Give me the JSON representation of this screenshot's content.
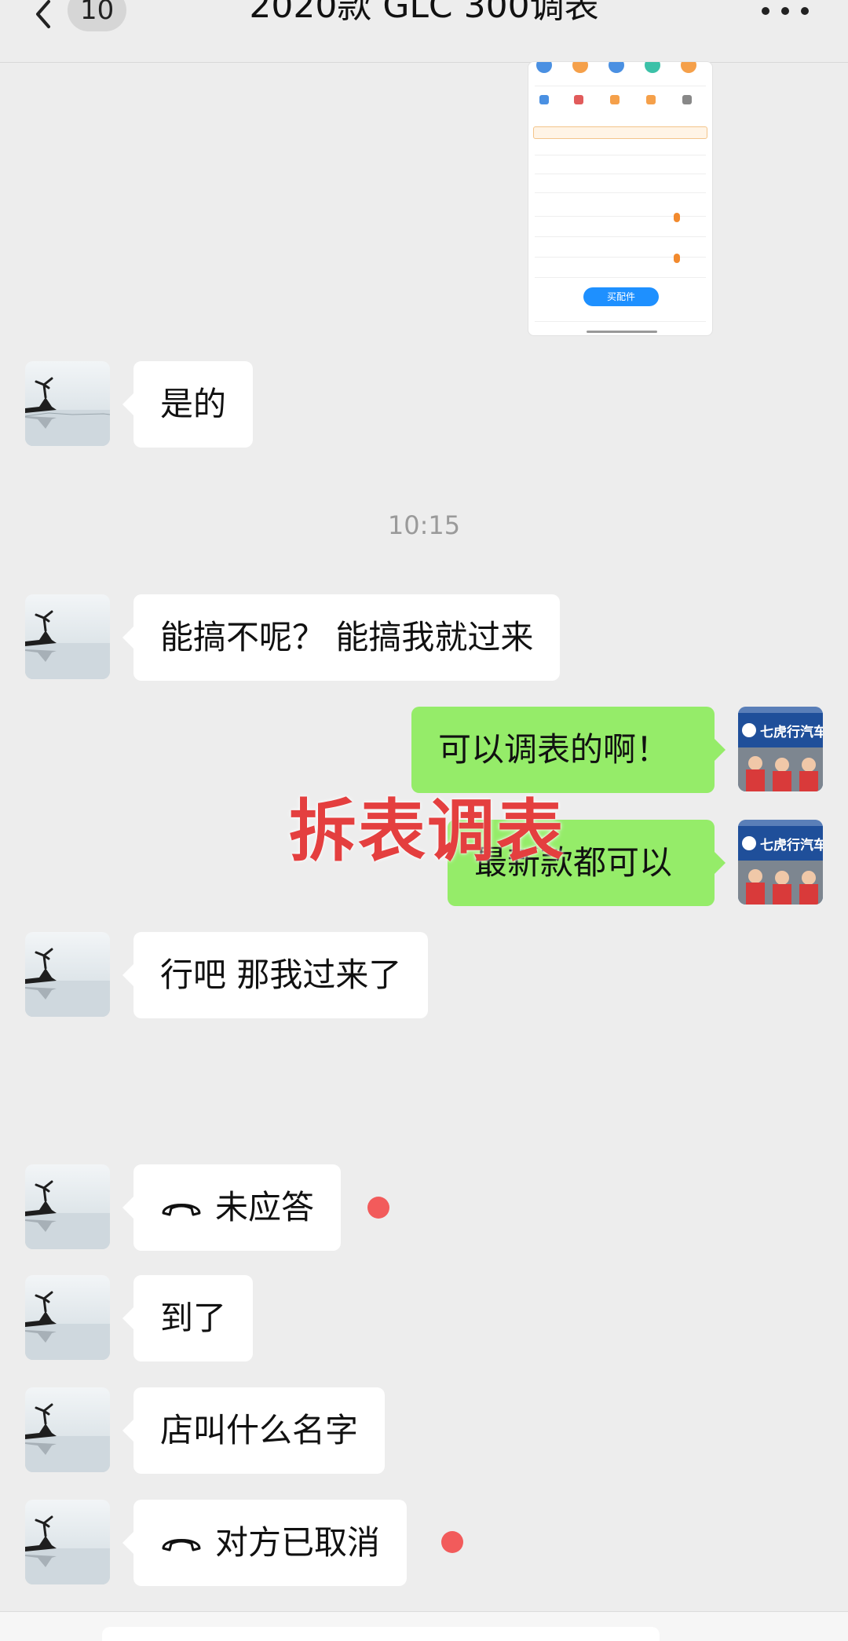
{
  "header": {
    "unread_count": "10",
    "title": "2020款 GLC 300调表"
  },
  "shared_image": {
    "buy_button": "买配件"
  },
  "timestamps": [
    "10:15"
  ],
  "messages": [
    {
      "side": "left",
      "text": "是的"
    },
    {
      "side": "left",
      "text": "能搞不呢？ 能搞我就过来"
    },
    {
      "side": "right",
      "text": "可以调表的啊！"
    },
    {
      "side": "right",
      "text": "最新款都可以"
    },
    {
      "side": "left",
      "text": "行吧 那我过来了"
    },
    {
      "side": "left",
      "type": "call",
      "text": "未应答"
    },
    {
      "side": "left",
      "text": "到了"
    },
    {
      "side": "left",
      "text": "店叫什么名字"
    },
    {
      "side": "left",
      "type": "call",
      "text": "对方已取消"
    }
  ],
  "overlay_caption": "拆表调表",
  "avatar_right": {
    "shop_sign": "七虎行汽车服务"
  },
  "colors": {
    "background": "#ededed",
    "incoming_bubble": "#ffffff",
    "outgoing_bubble": "#95ec69",
    "overlay_text": "#e43f3f",
    "unread_dot": "#f25b5b"
  }
}
